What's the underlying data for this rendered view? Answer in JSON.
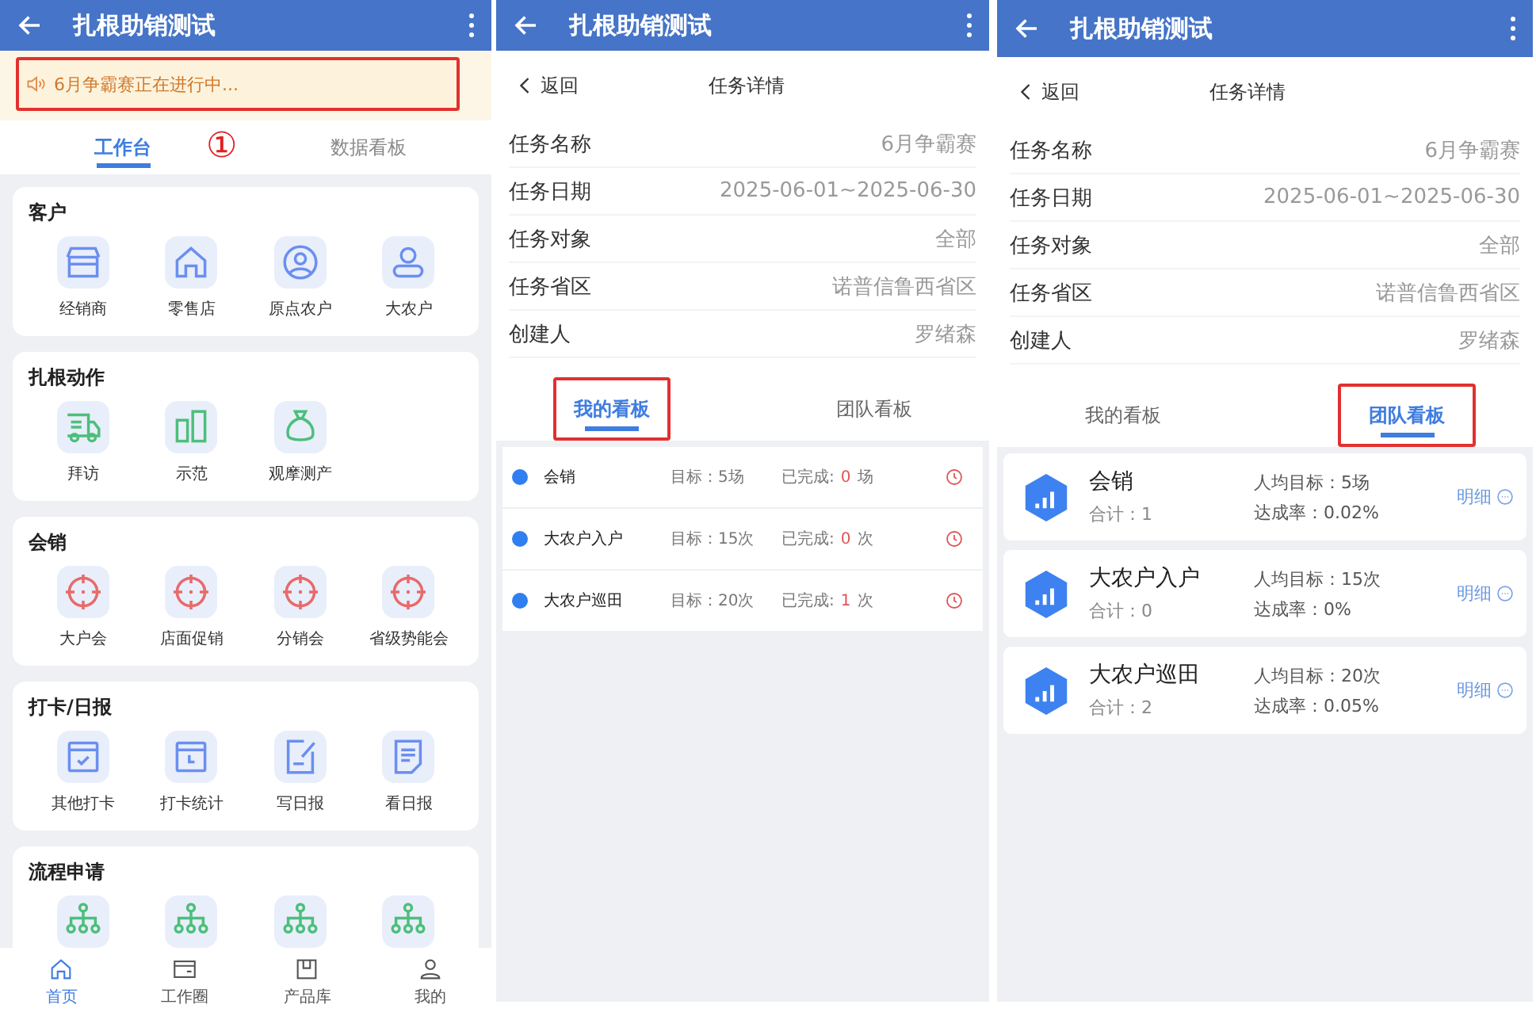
{
  "home": {
    "title": "扎根助销测试",
    "notice": {
      "text": "6月争霸赛正在进行中...",
      "highlighted": true
    },
    "annotation": "①",
    "tabs": [
      {
        "label": "工作台",
        "selected": true
      },
      {
        "label": "数据看板",
        "selected": false
      }
    ],
    "sections": [
      {
        "title": "客户",
        "items": [
          {
            "kind": "tile",
            "label": "经销商"
          },
          {
            "kind": "tile",
            "label": "零售店"
          },
          {
            "kind": "tile",
            "label": "原点农户"
          },
          {
            "kind": "tile",
            "label": "大农户"
          }
        ]
      },
      {
        "title": "扎根动作",
        "items": [
          {
            "kind": "tile",
            "label": "拜访"
          },
          {
            "kind": "tile",
            "label": "示范"
          },
          {
            "kind": "tile",
            "label": "观摩测产"
          }
        ]
      },
      {
        "title": "会销",
        "items": [
          {
            "kind": "tile",
            "label": "大户会"
          },
          {
            "kind": "tile",
            "label": "店面促销"
          },
          {
            "kind": "tile",
            "label": "分销会"
          },
          {
            "kind": "tile",
            "label": "省级势能会"
          }
        ]
      },
      {
        "title": "打卡/日报",
        "items": [
          {
            "kind": "tile",
            "label": "其他打卡"
          },
          {
            "kind": "tile",
            "label": "打卡统计"
          },
          {
            "kind": "tile",
            "label": "写日报"
          },
          {
            "kind": "tile",
            "label": "看日报"
          }
        ]
      },
      {
        "title": "流程申请",
        "items": [
          {
            "kind": "cut_off"
          },
          {
            "kind": "cut_off"
          },
          {
            "kind": "cut_off"
          },
          {
            "kind": "cut_off"
          }
        ]
      }
    ],
    "bottom_nav": [
      {
        "label": "首页",
        "selected": true
      },
      {
        "label": "工作圈",
        "selected": false
      },
      {
        "label": "产品库",
        "selected": false
      },
      {
        "label": "我的",
        "selected": false
      }
    ]
  },
  "details": [
    {
      "title": "扎根助销测试",
      "back": "返回",
      "page_title": "任务详情",
      "fields": [
        {
          "label": "任务名称",
          "value": "6月争霸赛"
        },
        {
          "label": "任务日期",
          "value": "2025-06-01~2025-06-30"
        },
        {
          "label": "任务对象",
          "value": "全部"
        },
        {
          "label": "任务省区",
          "value": "诺普信鲁西省区"
        },
        {
          "label": "创建人",
          "value": "罗绪森"
        }
      ],
      "tabs": [
        {
          "label": "我的看板",
          "selected": true,
          "highlighted": true
        },
        {
          "label": "团队看板",
          "selected": false,
          "highlighted": false
        }
      ],
      "kind": "mine",
      "rows": [
        {
          "name": "会销",
          "target": "目标：5场",
          "done_label": "已完成:",
          "done": "0",
          "unit": "场"
        },
        {
          "name": "大农户入户",
          "target": "目标：15次",
          "done_label": "已完成:",
          "done": "0",
          "unit": "次"
        },
        {
          "name": "大农户巡田",
          "target": "目标：20次",
          "done_label": "已完成:",
          "done": "1",
          "unit": "次"
        }
      ]
    },
    {
      "title": "扎根助销测试",
      "back": "返回",
      "page_title": "任务详情",
      "fields": [
        {
          "label": "任务名称",
          "value": "6月争霸赛"
        },
        {
          "label": "任务日期",
          "value": "2025-06-01~2025-06-30"
        },
        {
          "label": "任务对象",
          "value": "全部"
        },
        {
          "label": "任务省区",
          "value": "诺普信鲁西省区"
        },
        {
          "label": "创建人",
          "value": "罗绪森"
        }
      ],
      "tabs": [
        {
          "label": "我的看板",
          "selected": false,
          "highlighted": false
        },
        {
          "label": "团队看板",
          "selected": true,
          "highlighted": true
        }
      ],
      "kind": "team",
      "cards": [
        {
          "name": "会销",
          "total": "合计：1",
          "target": "人均目标：5场",
          "rate": "达成率：0.02%",
          "link": "明细"
        },
        {
          "name": "大农户入户",
          "total": "合计：0",
          "target": "人均目标：15次",
          "rate": "达成率：0%",
          "link": "明细"
        },
        {
          "name": "大农户巡田",
          "total": "合计：2",
          "target": "人均目标：20次",
          "rate": "达成率：0.05%",
          "link": "明细"
        }
      ]
    }
  ]
}
